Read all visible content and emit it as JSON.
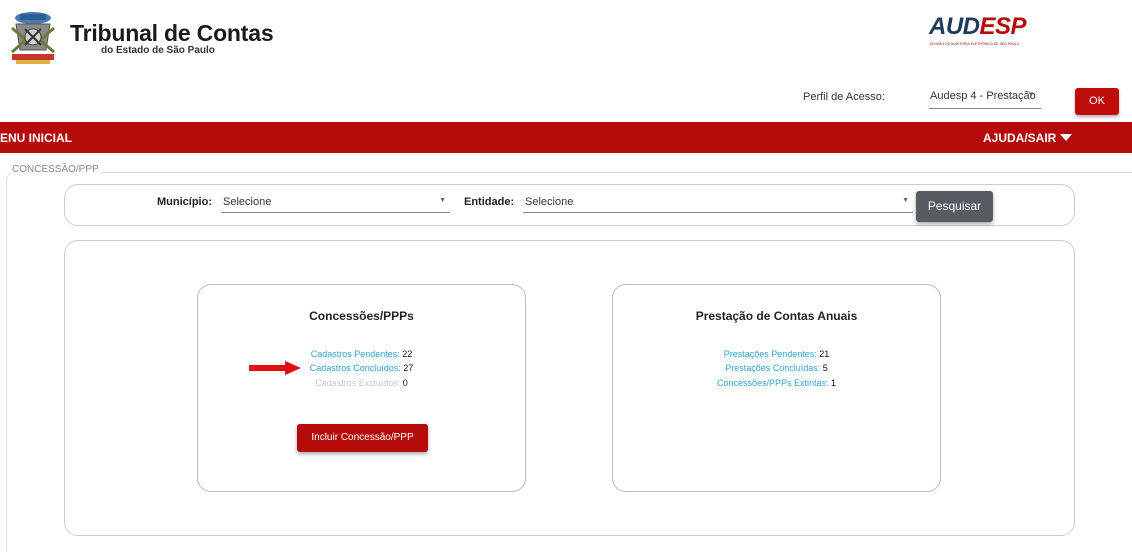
{
  "header": {
    "title": "Tribunal de Contas",
    "subtitle": "do Estado de São Paulo",
    "audesp_logo": {
      "prefix": "AUD",
      "accent": "ESP",
      "tagline": "DIVISÃO DE AUDITORIA ELETRÔNICA DE SÃO PAULO"
    },
    "emblem_icon": "coat-of-arms-icon"
  },
  "perfil": {
    "label": "Perfil de Acesso:",
    "value": "Audesp 4 - Prestação",
    "ok_label": "OK"
  },
  "navbar": {
    "menu_label": "ENU INICIAL",
    "help_label": "AJUDA/SAIR"
  },
  "section": {
    "title": "CONCESSÃO/PPP"
  },
  "search": {
    "municipio_label": "Município:",
    "municipio_value": "Selecione",
    "entidade_label": "Entidade:",
    "entidade_value": "Selecione",
    "button_label": "Pesquisar"
  },
  "cards": {
    "concessoes": {
      "title": "Concessões/PPPs",
      "pendentes_label": "Cadastros Pendentes:",
      "pendentes_value": "22",
      "concluidos_label": "Cadastros Concluídos:",
      "concluidos_value": "27",
      "excluidos_label": "Cadastros Excluídos:",
      "excluidos_value": "0",
      "button_label": "Incluir Concessão/PPP"
    },
    "prestacao": {
      "title": "Prestação de Contas Anuais",
      "pendentes_label": "Prestações Pendentes:",
      "pendentes_value": "21",
      "concluidas_label": "Prestações Concluídas:",
      "concluidas_value": "5",
      "extintas_label": "Concessões/PPPs Extintas:",
      "extintas_value": "1"
    }
  },
  "colors": {
    "brand_red": "#b60a0a",
    "link_blue": "#2fa3d6",
    "button_gray": "#575c63"
  }
}
